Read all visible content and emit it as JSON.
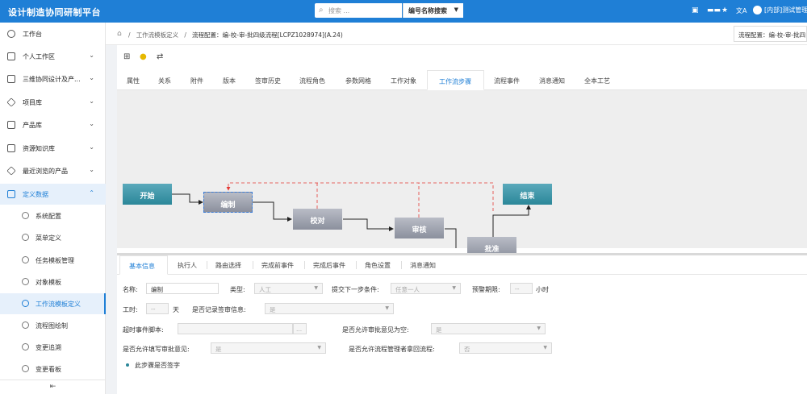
{
  "app": {
    "title": "设计制造协同研制平台"
  },
  "topbar": {
    "search_placeholder": "搜索 ...",
    "search_mode": "编号名称搜索",
    "icon_grid_label": "",
    "icon_star_label": "★",
    "icon_translate_label": "文A",
    "user_label": "[内部]测试管理"
  },
  "sidebar": {
    "items": [
      {
        "label": "工作台",
        "icon": "dashboard-icon",
        "chev": ""
      },
      {
        "label": "个人工作区",
        "icon": "monitor-icon",
        "chev": "⌄"
      },
      {
        "label": "三维协同设计及产...",
        "icon": "3d-design-icon",
        "chev": "⌄"
      },
      {
        "label": "项目库",
        "icon": "layers-icon",
        "chev": "⌄"
      },
      {
        "label": "产品库",
        "icon": "box-icon",
        "chev": "⌄"
      },
      {
        "label": "资源知识库",
        "icon": "database-icon",
        "chev": "⌄"
      },
      {
        "label": "最近浏览的产品",
        "icon": "layers-icon",
        "chev": "⌄"
      },
      {
        "label": "定义数据",
        "icon": "define-data-icon",
        "chev": "⌃"
      }
    ],
    "subitems": [
      {
        "label": "系统配置"
      },
      {
        "label": "菜单定义"
      },
      {
        "label": "任务模板管理"
      },
      {
        "label": "对象模板"
      },
      {
        "label": "工作流模板定义"
      },
      {
        "label": "流程图绘制"
      },
      {
        "label": "变更追溯"
      },
      {
        "label": "变更看板"
      }
    ],
    "collapse_label": "⇤"
  },
  "breadcrumb": {
    "home": "⌂",
    "sep": "/",
    "item1": "工作流模板定义",
    "item2": "流程配置：编-校-审-批四级流程[LCPZ1028974](A.24)",
    "tab_chip": "流程配置：编-校-审-批四"
  },
  "toolbar": {
    "icon1": "⊞",
    "icon2": "●",
    "icon3": "⇄"
  },
  "tabs": [
    {
      "label": "属性"
    },
    {
      "label": "关系"
    },
    {
      "label": "附件"
    },
    {
      "label": "版本"
    },
    {
      "label": "签审历史"
    },
    {
      "label": "流程角色"
    },
    {
      "label": "参数网格"
    },
    {
      "label": "工作对象"
    },
    {
      "label": "工作流步骤"
    },
    {
      "label": "流程事件"
    },
    {
      "label": "消息通知"
    },
    {
      "label": "全本工艺"
    }
  ],
  "flow": {
    "nodes": {
      "start": "开始",
      "edit": "编制",
      "check": "校对",
      "review": "审核",
      "approve": "批准",
      "end": "结束"
    },
    "colors": {
      "start_end": "#2b8799",
      "step": "#8b909d",
      "reject_line": "#e53935"
    }
  },
  "detail_tabs": [
    {
      "label": "基本信息"
    },
    {
      "label": "执行人"
    },
    {
      "label": "路由选择"
    },
    {
      "label": "完成前事件"
    },
    {
      "label": "完成后事件"
    },
    {
      "label": "角色设置"
    },
    {
      "label": "消息通知"
    }
  ],
  "form": {
    "name_label": "名称:",
    "name_value": "编制",
    "type_label": "类型:",
    "type_value": "人工",
    "next_cond_label": "提交下一步条件:",
    "next_cond_value": "任意一人",
    "warn_label": "预警期限:",
    "warn_value": "--",
    "warn_unit": "小时",
    "work_time_label": "工时:",
    "work_time_value": "--",
    "work_time_unit": "天",
    "record_sign_label": "是否记录签审信息:",
    "record_sign_value": "是",
    "timeout_script_label": "超时事件脚本:",
    "timeout_script_value": "",
    "timeout_btn": "...",
    "allow_empty_label": "是否允许审批意见为空:",
    "allow_empty_value": "是",
    "allow_fill_label": "是否允许填写审批意见:",
    "allow_fill_value": "是",
    "allow_reject_label": "是否允许流程管理者拿回流程:",
    "allow_reject_value": "否",
    "sign_label": "此步骤是否签字"
  }
}
